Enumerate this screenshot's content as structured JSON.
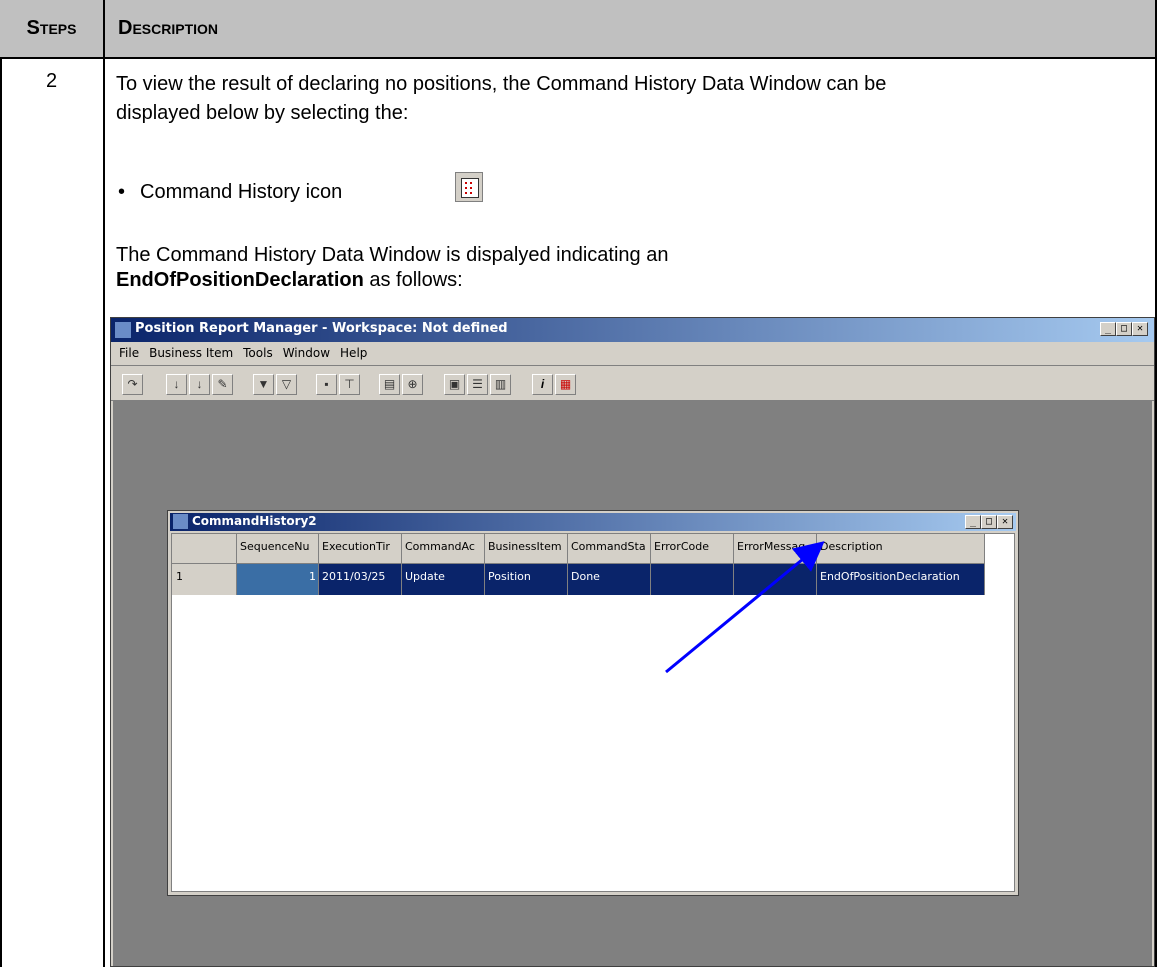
{
  "table": {
    "header_steps": "Steps",
    "header_description": "Description",
    "step_number": "2"
  },
  "content": {
    "line1": "To view the result of declaring no positions, the Command History Data Window can be",
    "line2": "displayed below by selecting the:",
    "bullet": "•",
    "bullet_text": "Command History icon",
    "para2_line1": "The Command History Data Window is dispalyed indicating an",
    "para2_bold": "EndOfPositionDeclaration",
    "para2_rest": " as follows:"
  },
  "app": {
    "title": "Position Report Manager - Workspace: Not defined",
    "menu": [
      "File",
      "Business Item",
      "Tools",
      "Window",
      "Help"
    ],
    "window_buttons": [
      "_",
      "□",
      "✕"
    ],
    "child": {
      "title": "CommandHistory2",
      "columns": [
        "SequenceNu",
        "ExecutionTir",
        "CommandAc",
        "BusinessItem",
        "CommandSta",
        "ErrorCode",
        "ErrorMessag",
        "Description"
      ],
      "rows": [
        {
          "row_label": "1",
          "cells": [
            "1",
            "2011/03/25",
            "Update",
            "Position",
            "Done",
            "",
            "",
            "EndOfPositionDeclaration"
          ]
        }
      ]
    }
  },
  "colors": {
    "header_bg": "#c0c0c0",
    "titlebar": "#0a246a",
    "selection": "#0a246a",
    "arrow": "#0000ff",
    "workspace": "#808080"
  }
}
